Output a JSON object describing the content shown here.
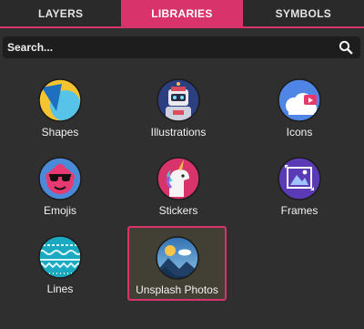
{
  "tabs": [
    {
      "label": "LAYERS",
      "active": false
    },
    {
      "label": "LIBRARIES",
      "active": true
    },
    {
      "label": "SYMBOLS",
      "active": false
    }
  ],
  "search": {
    "placeholder": "Search...",
    "value": ""
  },
  "libraries": [
    {
      "label": "Shapes",
      "icon": "shapes-icon"
    },
    {
      "label": "Illustrations",
      "icon": "robot-illustration-icon"
    },
    {
      "label": "Icons",
      "icon": "icons-cloud-icon"
    },
    {
      "label": "Emojis",
      "icon": "sunglasses-emoji-icon"
    },
    {
      "label": "Stickers",
      "icon": "unicorn-sticker-icon"
    },
    {
      "label": "Frames",
      "icon": "frame-picture-icon"
    },
    {
      "label": "Lines",
      "icon": "lines-pattern-icon"
    },
    {
      "label": "Unsplash Photos",
      "icon": "mountain-photo-icon",
      "selected": true
    }
  ],
  "colors": {
    "accent": "#d9336b",
    "background": "#2f2f2f",
    "selected_bg": "#423f34"
  }
}
